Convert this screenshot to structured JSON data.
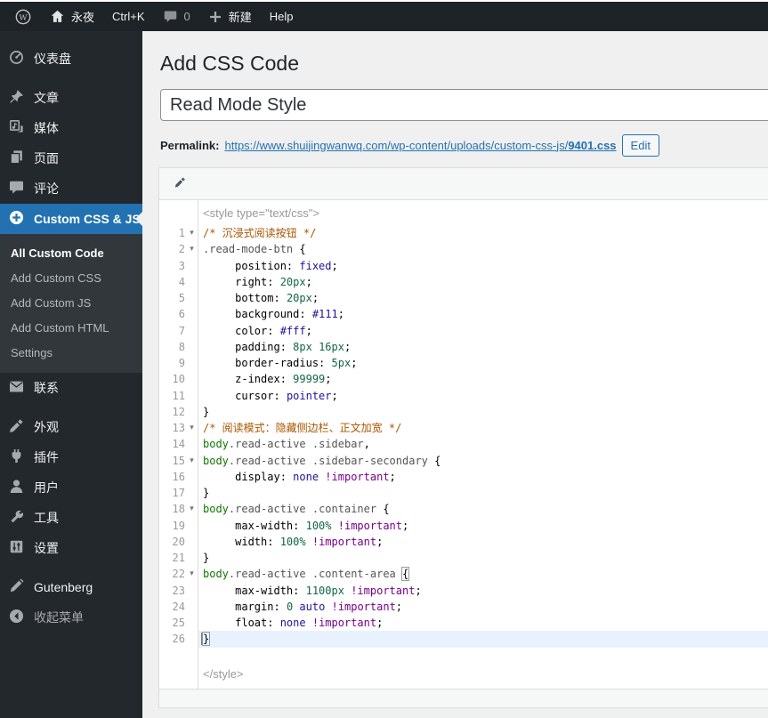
{
  "admin_bar": {
    "site_name": "永夜",
    "shortcut": "Ctrl+K",
    "comments_count": "0",
    "new_label": "新建",
    "help_label": "Help"
  },
  "sidebar": {
    "items": [
      {
        "label": "仪表盘"
      },
      {
        "label": "文章"
      },
      {
        "label": "媒体"
      },
      {
        "label": "页面"
      },
      {
        "label": "评论"
      },
      {
        "label": "Custom CSS & JS"
      },
      {
        "label": "联系"
      },
      {
        "label": "外观"
      },
      {
        "label": "插件"
      },
      {
        "label": "用户"
      },
      {
        "label": "工具"
      },
      {
        "label": "设置"
      },
      {
        "label": "Gutenberg"
      },
      {
        "label": "收起菜单"
      }
    ],
    "submenu": [
      "All Custom Code",
      "Add Custom CSS",
      "Add Custom JS",
      "Add Custom HTML",
      "Settings"
    ]
  },
  "main": {
    "page_title": "Add CSS Code",
    "title_input": {
      "value": "Read Mode Style"
    },
    "permalink": {
      "label": "Permalink:",
      "url_base": "https://www.shuijingwanwq.com/wp-content/uploads/custom-css-js/",
      "url_slug": "9401.css",
      "edit_label": "Edit"
    }
  },
  "editor": {
    "header_line": "<style type=\"text/css\">",
    "footer_line": "</style>",
    "active_line": 26,
    "lines": [
      {
        "n": 1,
        "f": true,
        "s": [
          [
            "c",
            "/* 沉浸式阅读按钮 */"
          ]
        ]
      },
      {
        "n": 2,
        "f": true,
        "s": [
          [
            "q",
            ".read-mode-btn"
          ],
          [
            "d",
            " {"
          ]
        ]
      },
      {
        "n": 3,
        "s": [
          [
            "d",
            "     "
          ],
          [
            "p",
            "position"
          ],
          [
            "d",
            ": "
          ],
          [
            "a",
            "fixed"
          ],
          [
            "d",
            ";"
          ]
        ]
      },
      {
        "n": 4,
        "s": [
          [
            "d",
            "     "
          ],
          [
            "p",
            "right"
          ],
          [
            "d",
            ": "
          ],
          [
            "n",
            "20px"
          ],
          [
            "d",
            ";"
          ]
        ]
      },
      {
        "n": 5,
        "s": [
          [
            "d",
            "     "
          ],
          [
            "p",
            "bottom"
          ],
          [
            "d",
            ": "
          ],
          [
            "n",
            "20px"
          ],
          [
            "d",
            ";"
          ]
        ]
      },
      {
        "n": 6,
        "s": [
          [
            "d",
            "     "
          ],
          [
            "p",
            "background"
          ],
          [
            "d",
            ": "
          ],
          [
            "a",
            "#111"
          ],
          [
            "d",
            ";"
          ]
        ]
      },
      {
        "n": 7,
        "s": [
          [
            "d",
            "     "
          ],
          [
            "p",
            "color"
          ],
          [
            "d",
            ": "
          ],
          [
            "a",
            "#fff"
          ],
          [
            "d",
            ";"
          ]
        ]
      },
      {
        "n": 8,
        "s": [
          [
            "d",
            "     "
          ],
          [
            "p",
            "padding"
          ],
          [
            "d",
            ": "
          ],
          [
            "n",
            "8px"
          ],
          [
            "d",
            " "
          ],
          [
            "n",
            "16px"
          ],
          [
            "d",
            ";"
          ]
        ]
      },
      {
        "n": 9,
        "s": [
          [
            "d",
            "     "
          ],
          [
            "p",
            "border-radius"
          ],
          [
            "d",
            ": "
          ],
          [
            "n",
            "5px"
          ],
          [
            "d",
            ";"
          ]
        ]
      },
      {
        "n": 10,
        "s": [
          [
            "d",
            "     "
          ],
          [
            "p",
            "z-index"
          ],
          [
            "d",
            ": "
          ],
          [
            "n",
            "99999"
          ],
          [
            "d",
            ";"
          ]
        ]
      },
      {
        "n": 11,
        "s": [
          [
            "d",
            "     "
          ],
          [
            "p",
            "cursor"
          ],
          [
            "d",
            ": "
          ],
          [
            "a",
            "pointer"
          ],
          [
            "d",
            ";"
          ]
        ]
      },
      {
        "n": 12,
        "s": [
          [
            "d",
            "}"
          ]
        ]
      },
      {
        "n": 13,
        "f": true,
        "s": [
          [
            "c",
            "/* 阅读模式：隐藏侧边栏、正文加宽 */"
          ]
        ]
      },
      {
        "n": 14,
        "s": [
          [
            "t",
            "body"
          ],
          [
            "q",
            ".read-active"
          ],
          [
            "d",
            " "
          ],
          [
            "q",
            ".sidebar"
          ],
          [
            "d",
            ","
          ]
        ]
      },
      {
        "n": 15,
        "f": true,
        "s": [
          [
            "t",
            "body"
          ],
          [
            "q",
            ".read-active"
          ],
          [
            "d",
            " "
          ],
          [
            "q",
            ".sidebar-secondary"
          ],
          [
            "d",
            " {"
          ]
        ]
      },
      {
        "n": 16,
        "s": [
          [
            "d",
            "     "
          ],
          [
            "p",
            "display"
          ],
          [
            "d",
            ": "
          ],
          [
            "a",
            "none"
          ],
          [
            "d",
            " "
          ],
          [
            "k",
            "!important"
          ],
          [
            "d",
            ";"
          ]
        ]
      },
      {
        "n": 17,
        "s": [
          [
            "d",
            "}"
          ]
        ]
      },
      {
        "n": 18,
        "f": true,
        "s": [
          [
            "t",
            "body"
          ],
          [
            "q",
            ".read-active"
          ],
          [
            "d",
            " "
          ],
          [
            "q",
            ".container"
          ],
          [
            "d",
            " {"
          ]
        ]
      },
      {
        "n": 19,
        "s": [
          [
            "d",
            "     "
          ],
          [
            "p",
            "max-width"
          ],
          [
            "d",
            ": "
          ],
          [
            "n",
            "100%"
          ],
          [
            "d",
            " "
          ],
          [
            "k",
            "!important"
          ],
          [
            "d",
            ";"
          ]
        ]
      },
      {
        "n": 20,
        "s": [
          [
            "d",
            "     "
          ],
          [
            "p",
            "width"
          ],
          [
            "d",
            ": "
          ],
          [
            "n",
            "100%"
          ],
          [
            "d",
            " "
          ],
          [
            "k",
            "!important"
          ],
          [
            "d",
            ";"
          ]
        ]
      },
      {
        "n": 21,
        "s": [
          [
            "d",
            "}"
          ]
        ]
      },
      {
        "n": 22,
        "f": true,
        "s": [
          [
            "t",
            "body"
          ],
          [
            "q",
            ".read-active"
          ],
          [
            "d",
            " "
          ],
          [
            "q",
            ".content-area"
          ],
          [
            "d",
            " "
          ],
          [
            "d",
            "{",
            "match"
          ]
        ]
      },
      {
        "n": 23,
        "s": [
          [
            "d",
            "     "
          ],
          [
            "p",
            "max-width"
          ],
          [
            "d",
            ": "
          ],
          [
            "n",
            "1100px"
          ],
          [
            "d",
            " "
          ],
          [
            "k",
            "!important"
          ],
          [
            "d",
            ";"
          ]
        ]
      },
      {
        "n": 24,
        "s": [
          [
            "d",
            "     "
          ],
          [
            "p",
            "margin"
          ],
          [
            "d",
            ": "
          ],
          [
            "n",
            "0"
          ],
          [
            "d",
            " "
          ],
          [
            "a",
            "auto"
          ],
          [
            "d",
            " "
          ],
          [
            "k",
            "!important"
          ],
          [
            "d",
            ";"
          ]
        ]
      },
      {
        "n": 25,
        "s": [
          [
            "d",
            "     "
          ],
          [
            "p",
            "float"
          ],
          [
            "d",
            ": "
          ],
          [
            "a",
            "none"
          ],
          [
            "d",
            " "
          ],
          [
            "k",
            "!important"
          ],
          [
            "d",
            ";"
          ]
        ]
      },
      {
        "n": 26,
        "s": [
          [
            "d",
            "}",
            "match cursor"
          ]
        ]
      }
    ]
  },
  "colors": {
    "accent": "#2271b1",
    "admin_bar_bg": "#1d2327",
    "sidebar_bg": "#23282d",
    "submenu_bg": "#32373c",
    "page_bg": "#f0f0f1",
    "active_line_bg": "#e8f2ff",
    "code_comment": "#aa5500",
    "code_tag": "#117700",
    "code_qualifier": "#555555",
    "code_atom": "#221199",
    "code_number": "#116644",
    "code_keyword": "#770088"
  }
}
